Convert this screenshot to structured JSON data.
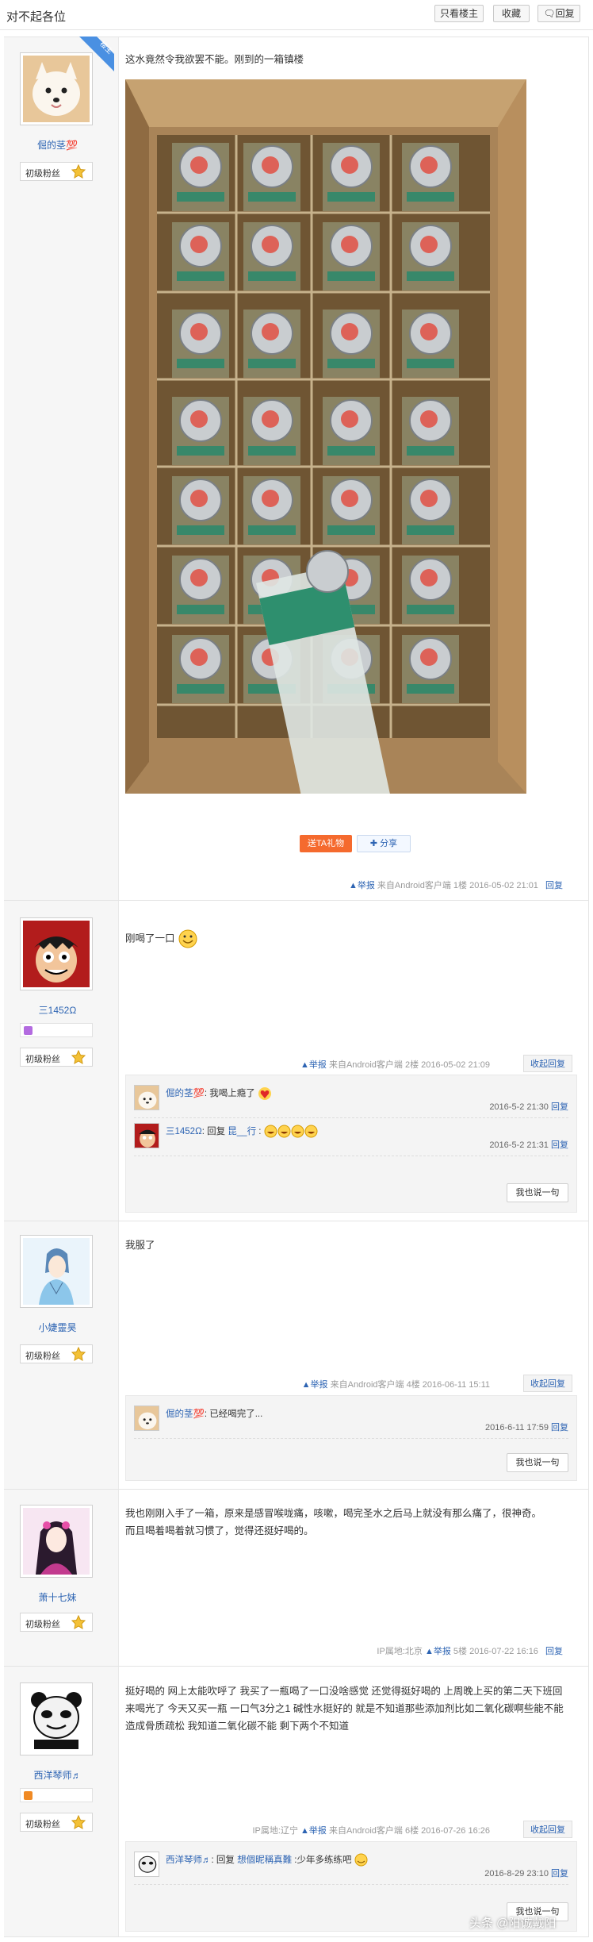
{
  "header": {
    "title": "对不起各位",
    "only_op": "只看楼主",
    "favorite": "收藏",
    "reply": "回复"
  },
  "common": {
    "fan_level": "初级粉丝",
    "report": "▲举报",
    "reply": "回复",
    "collapse_reply": "收起回复",
    "say_one": "我也说一句",
    "source": "来自Android客户端"
  },
  "ribbon": "楼主",
  "posts": [
    {
      "user": "倔的茎💯",
      "text": "这水竟然令我欲罢不能。刚到的一箱镇楼",
      "gift": "送TA礼物",
      "share": "分享",
      "floor": "1楼",
      "time": "2016-05-02 21:01"
    },
    {
      "user": "三1452Ω",
      "text": "刚喝了一口",
      "floor": "2楼",
      "time": "2016-05-02 21:09",
      "replies": [
        {
          "name": "倔的茎💯",
          "text": ": 我喝上瘾了",
          "time": "2016-5-2 21:30"
        },
        {
          "name": "三1452Ω",
          "prefix": ": 回复 ",
          "target": "昆__行",
          "text": " :",
          "time": "2016-5-2 21:31"
        }
      ]
    },
    {
      "user": "小婕靈昊",
      "text": "我服了",
      "floor": "4楼",
      "time": "2016-06-11 15:11",
      "replies": [
        {
          "name": "倔的茎💯",
          "text": ": 已经喝完了...",
          "time": "2016-6-11 17:59"
        }
      ]
    },
    {
      "user": "萧十七妹",
      "text1": "我也刚刚入手了一箱，原来是感冒喉咙痛，咳嗽，喝完圣水之后马上就没有那么痛了，很神奇。",
      "text2": "而且喝着喝着就习惯了，觉得还挺好喝的。",
      "ip": "IP属地:北京",
      "floor": "5楼",
      "time": "2016-07-22 16:16"
    },
    {
      "user": "西洋琴师♬",
      "text": "挺好喝的 网上太能吹呼了 我买了一瓶喝了一口没啥感觉 还觉得挺好喝的 上周晚上买的第二天下班回来喝光了 今天又买一瓶 一口气3分之1 碱性水挺好的 就是不知道那些添加剂比如二氧化碳啊些能不能造成骨质疏松 我知道二氧化碳不能 剩下两个不知道",
      "ip": "IP属地:辽宁",
      "floor": "6楼",
      "time": "2016-07-26 16:26",
      "replies": [
        {
          "name": "西洋琴师♬",
          "prefix": ": 回复 ",
          "target": "想個昵稱真難",
          "text": " :少年多练练吧",
          "time": "2016-8-29 23:10"
        }
      ]
    }
  ],
  "watermark": "头条 @阳诚戴阳",
  "colors": {
    "link": "#2d64b3",
    "gift": "#f56a2e",
    "panel": "#f6f6f6"
  }
}
